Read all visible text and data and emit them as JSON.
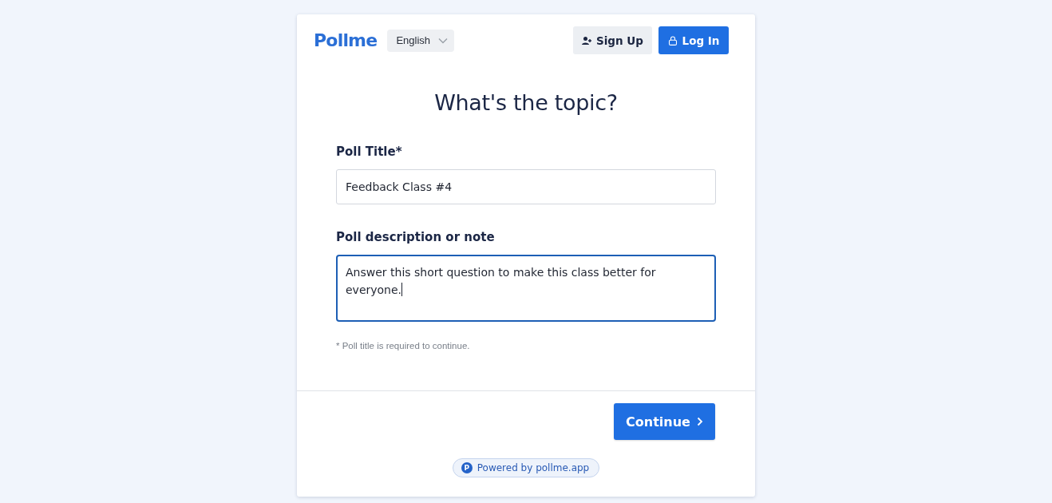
{
  "header": {
    "logo": "Pollme",
    "language": "English",
    "buttons": [
      {
        "label": "Sign Up",
        "kind": "secondary"
      },
      {
        "label": "Log In",
        "kind": "primary"
      }
    ]
  },
  "form": {
    "heading": "What's the topic?",
    "fields": [
      {
        "label": "Poll Title*",
        "kind": "input",
        "value": "Feedback Class #4",
        "focused": false
      },
      {
        "label": "Poll description or note",
        "kind": "textarea",
        "value": "Answer this short question to make this class better for everyone.",
        "focused": true
      }
    ],
    "note": "* Poll title is required to continue."
  },
  "footer": {
    "continue_button": "Continue",
    "powered_by": {
      "icon_letter": "P",
      "text": "Powered by pollme.app"
    }
  }
}
